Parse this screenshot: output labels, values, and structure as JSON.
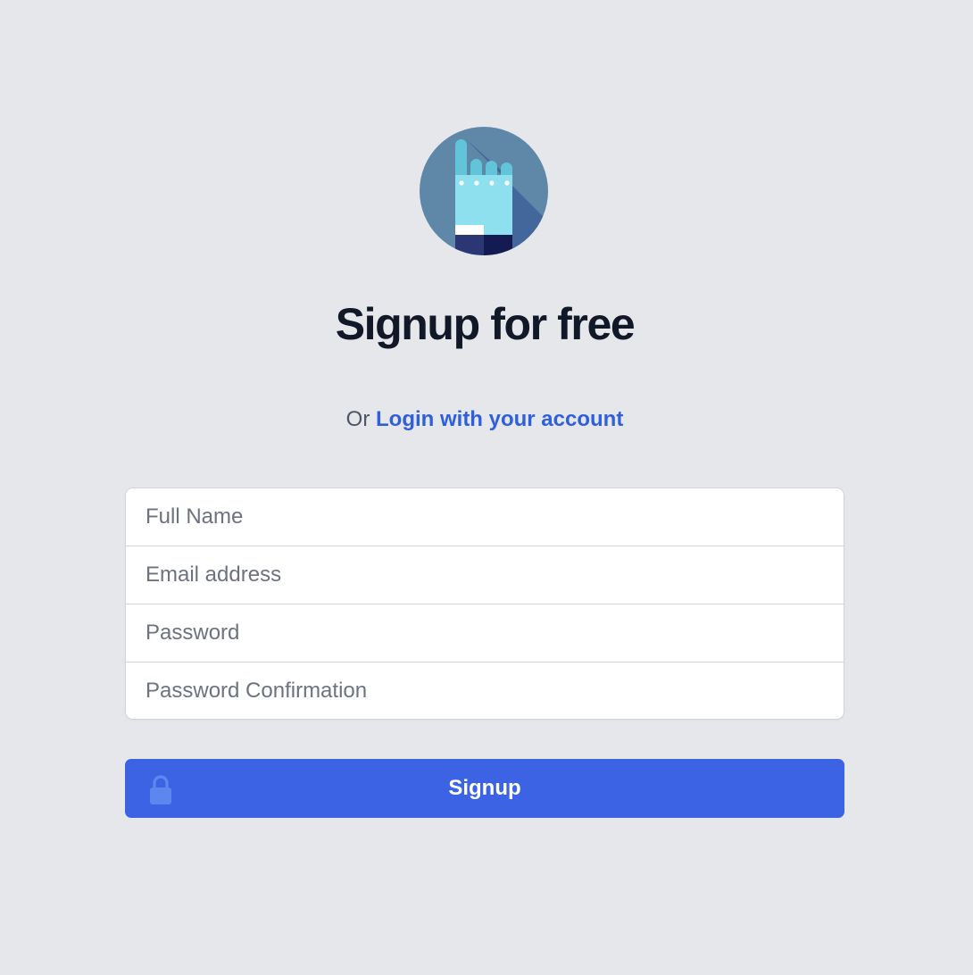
{
  "logo": {
    "icon": "raised-hand-index-finger-icon",
    "colors": {
      "circle": "#5f87a8",
      "shadow": "#43679a",
      "glove": "#8fe0ef",
      "finger": "#62c4d9",
      "cuff": "#ffffff",
      "sleeve_left": "#2b3775",
      "sleeve_right": "#141a52"
    }
  },
  "page": {
    "title": "Signup for free",
    "subtitle_prefix": "Or",
    "login_link": "Login with your account"
  },
  "form": {
    "fields": [
      {
        "placeholder": "Full Name",
        "value": ""
      },
      {
        "placeholder": "Email address",
        "value": ""
      },
      {
        "placeholder": "Password",
        "value": ""
      },
      {
        "placeholder": "Password Confirmation",
        "value": ""
      }
    ],
    "submit_label": "Signup",
    "submit_icon": "lock-icon"
  },
  "colors": {
    "background": "#e5e7eb",
    "accent": "#3b63e3",
    "link": "#2f5fdb",
    "title": "#111827"
  }
}
